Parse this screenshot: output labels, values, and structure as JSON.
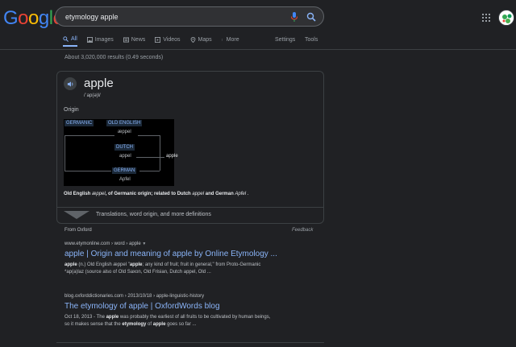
{
  "logo": {
    "letters": [
      "G",
      "o",
      "o",
      "g",
      "l",
      "e"
    ],
    "colors": [
      "#4285f4",
      "#ea4335",
      "#fbbc05",
      "#4285f4",
      "#34a853",
      "#ea4335"
    ]
  },
  "search": {
    "value": "etymology apple"
  },
  "tabs": [
    {
      "label": "All",
      "icon": "search-icon"
    },
    {
      "label": "Images",
      "icon": "image-icon"
    },
    {
      "label": "News",
      "icon": "news-icon"
    },
    {
      "label": "Videos",
      "icon": "video-icon"
    },
    {
      "label": "Maps",
      "icon": "map-pin-icon"
    },
    {
      "label": "More",
      "icon": "more-vert-icon"
    }
  ],
  "tools": {
    "settings": "Settings",
    "tools": "Tools"
  },
  "stats": "About 3,020,000 results (0.49 seconds)",
  "dictionary": {
    "word": "apple",
    "pronunciation": "/ˈap(ə)l/",
    "origin_label": "Origin",
    "tree": {
      "germanic": "GERMANIC",
      "old_english": "OLD ENGLISH",
      "aeppel": "æppel",
      "dutch": "DUTCH",
      "appel": "appel",
      "german": "GERMAN",
      "apfel": "Apfel",
      "apple": "apple"
    },
    "etymology_parts": {
      "p1": "Old English ",
      "p2": "æppel",
      "p3": ", of Germanic origin; related to Dutch ",
      "p4": "appel",
      "p5": " and German ",
      "p6": "Apfel",
      "p7": " ."
    },
    "more": "Translations, word origin, and more definitions"
  },
  "source": {
    "from": "From Oxford",
    "feedback": "Feedback"
  },
  "results": [
    {
      "url": "www.etymonline.com › word › apple",
      "title": "apple | Origin and meaning of apple by Online Etymology ...",
      "snippet": {
        "s1": "apple",
        "s2": " (n.) Old English æppel \"",
        "s3": "apple",
        "s4": "; any kind of fruit; fruit in general,\" from Proto-Germanic",
        "s5": "*ap(a)laz (source also of Old Saxon, Old Frisian, Dutch appel, Old ..."
      }
    },
    {
      "url": "blog.oxforddictionaries.com › 2013/10/18 › apple-linguistic-history",
      "title": "The etymology of apple | OxfordWords blog",
      "snippet": {
        "s1": "Oct 18, 2013 - The ",
        "s2": "apple",
        "s3": " was probably the earliest of all fruits to be cultivated by human beings,",
        "s4": "so it makes sense that the ",
        "s5": "etymology",
        "s6": " of ",
        "s7": "apple",
        "s8": " goes so far ..."
      }
    }
  ]
}
